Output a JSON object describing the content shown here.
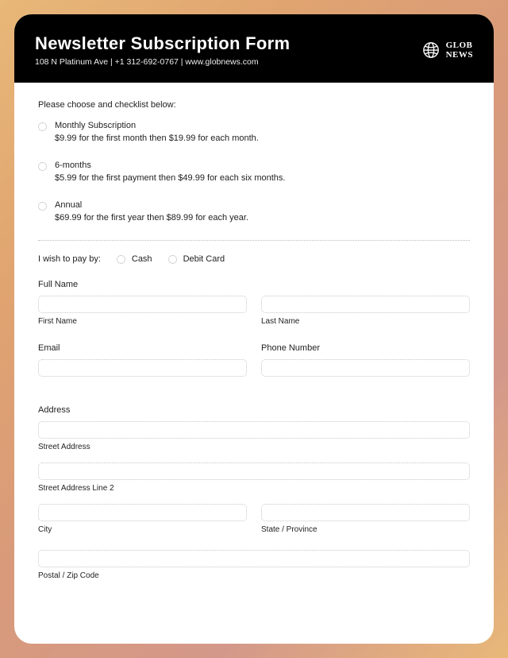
{
  "header": {
    "title": "Newsletter Subscription Form",
    "subtitle": "108 N Platinum Ave | +1 312-692-0767 | www.globnews.com",
    "logo": {
      "line1": "GLOB",
      "line2": "NEWS"
    }
  },
  "prompt": "Please choose and checklist below:",
  "plans": [
    {
      "name": "Monthly Subscription",
      "desc": "$9.99 for the first month then $19.99 for each month."
    },
    {
      "name": "6-months",
      "desc": "$5.99 for the first payment then $49.99 for each six months."
    },
    {
      "name": "Annual",
      "desc": "$69.99 for the first year then $89.99 for each year."
    }
  ],
  "payLabel": "I wish to pay by:",
  "payOptions": [
    "Cash",
    "Debit Card"
  ],
  "fields": {
    "fullName": "Full Name",
    "firstName": "First Name",
    "lastName": "Last Name",
    "email": "Email",
    "phone": "Phone Number",
    "address": "Address",
    "street": "Street Address",
    "street2": "Street Address Line 2",
    "city": "City",
    "state": "State / Province",
    "postal": "Postal / Zip Code"
  }
}
